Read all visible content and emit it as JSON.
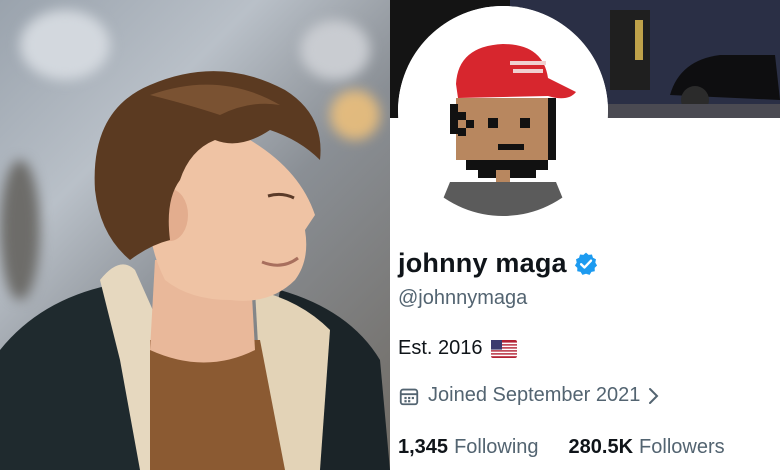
{
  "profile": {
    "display_name": "johnny maga",
    "handle": "@johnnymaga",
    "bio": "Est. 2016",
    "bio_flag_icon": "us-flag-icon",
    "verified_icon": "verified-badge-icon",
    "joined_icon": "calendar-icon",
    "joined": "Joined September 2021",
    "following": {
      "count": "1,345",
      "label": "Following"
    },
    "followers": {
      "count": "280.5K",
      "label": "Followers"
    }
  },
  "colors": {
    "verified": "#1d9bf0",
    "name": "#0f1419",
    "secondary": "#536471",
    "hat": "#d7262e"
  }
}
